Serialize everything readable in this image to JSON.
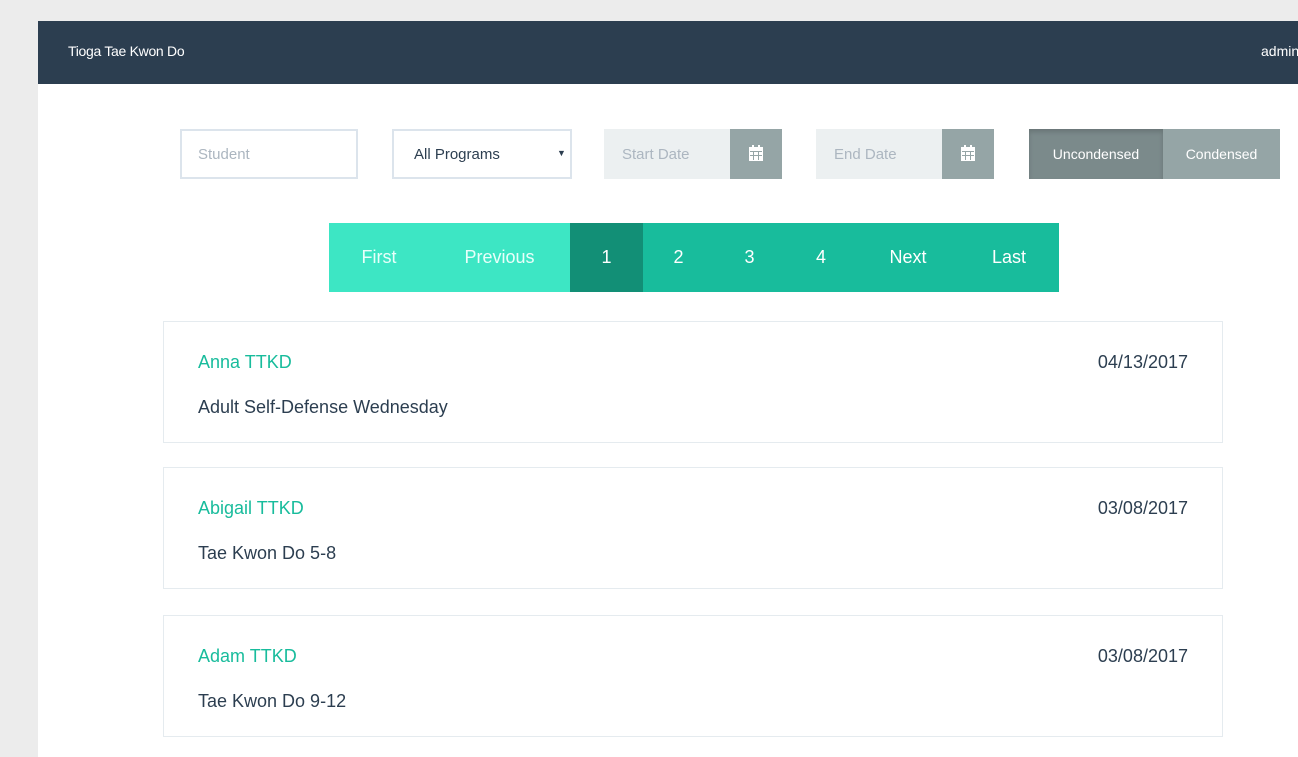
{
  "navbar": {
    "brand": "Tioga Tae Kwon Do",
    "user": "admin"
  },
  "filters": {
    "student_placeholder": "Student",
    "program_selected": "All Programs",
    "start_date_placeholder": "Start Date",
    "end_date_placeholder": "End Date",
    "uncondensed_label": "Uncondensed",
    "condensed_label": "Condensed",
    "view_mode": "Uncondensed"
  },
  "pagination": {
    "first": "First",
    "previous": "Previous",
    "pages": [
      "1",
      "2",
      "3",
      "4"
    ],
    "current_page": "1",
    "next": "Next",
    "last": "Last"
  },
  "records": [
    {
      "name": "Anna TTKD",
      "date": "04/13/2017",
      "program": "Adult Self-Defense Wednesday"
    },
    {
      "name": "Abigail TTKD",
      "date": "03/08/2017",
      "program": "Tae Kwon Do 5-8"
    },
    {
      "name": "Adam TTKD",
      "date": "03/08/2017",
      "program": "Tae Kwon Do 9-12"
    }
  ],
  "colors": {
    "navbar": "#2c3e50",
    "accent": "#18bc9c",
    "active_page": "#128f76",
    "disabled_page": "#3de6c4",
    "toggle_active": "#7b8a8b",
    "toggle": "#95a5a6"
  },
  "icons": {
    "calendar": "calendar-icon",
    "dropdown": "caret-down-icon"
  }
}
